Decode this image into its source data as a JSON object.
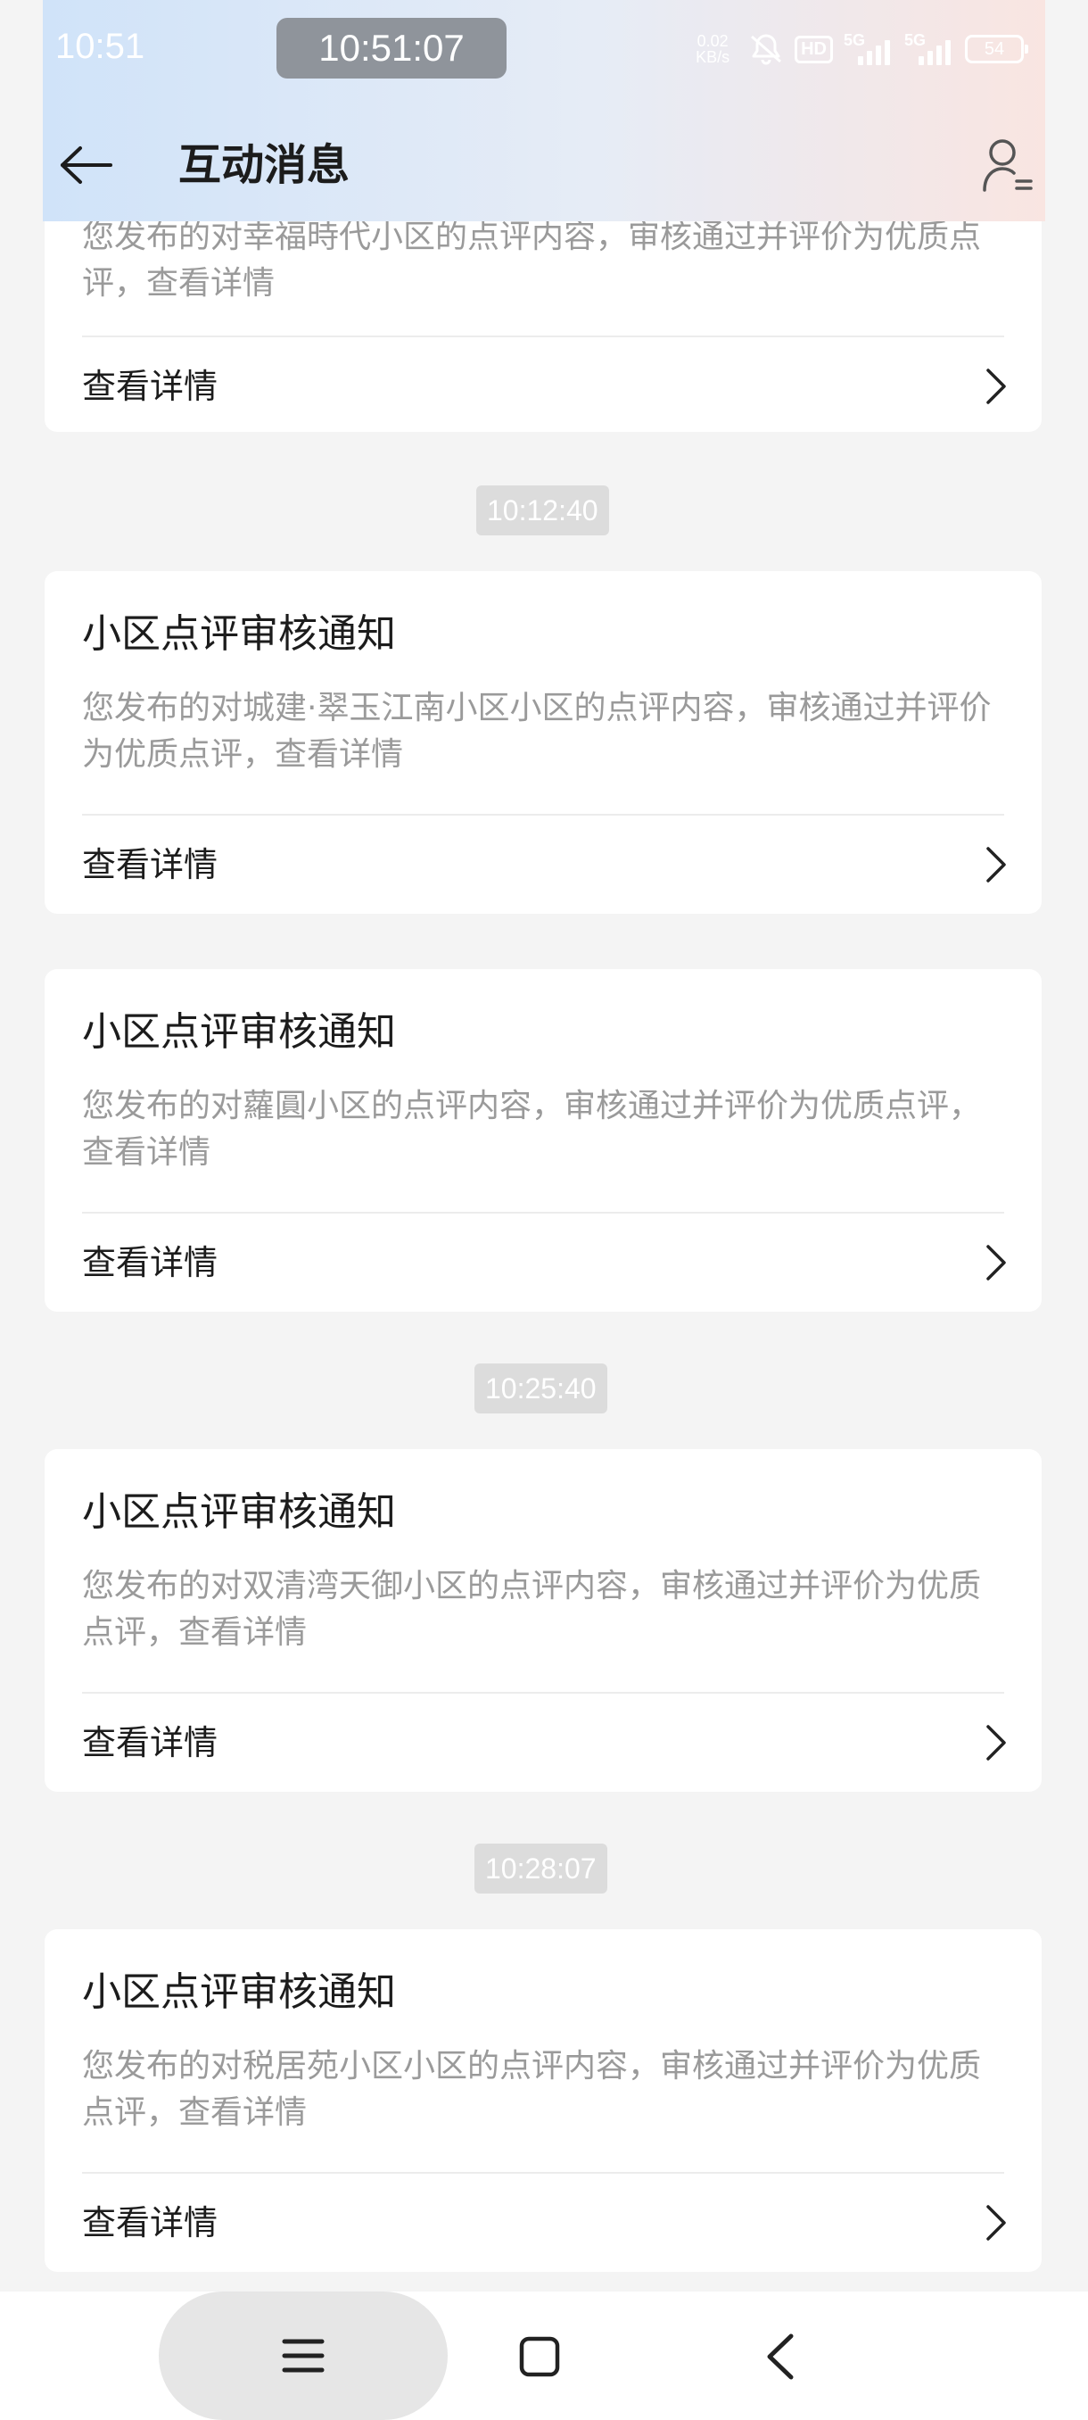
{
  "status_bar": {
    "time": "10:51",
    "clock": "10:51:07",
    "net_speed_value": "0.02",
    "net_speed_unit": "KB/s",
    "hd_label": "HD",
    "signal_1": "5G",
    "signal_2": "5G",
    "battery": "54"
  },
  "header": {
    "title": "互动消息"
  },
  "feed": {
    "partial_card": {
      "body": "您发布的对幸福時代小区的点评内容，审核通过并评价为优质点评，查看详情",
      "action": "查看详情"
    },
    "timestamps": [
      "10:12:40",
      "10:25:40",
      "10:28:07"
    ],
    "cards": [
      {
        "title": "小区点评审核通知",
        "body": "您发布的对城建·翠玉江南小区小区的点评内容，审核通过并评价为优质点评，查看详情",
        "action": "查看详情"
      },
      {
        "title": "小区点评审核通知",
        "body": "您发布的对蘿圓小区的点评内容，审核通过并评价为优质点评，查看详情",
        "action": "查看详情"
      },
      {
        "title": "小区点评审核通知",
        "body": "您发布的对双清湾天御小区的点评内容，审核通过并评价为优质点评，查看详情",
        "action": "查看详情"
      },
      {
        "title": "小区点评审核通知",
        "body": "您发布的对税居苑小区小区的点评内容，审核通过并评价为优质点评，查看详情",
        "action": "查看详情"
      }
    ]
  },
  "icons": {
    "back": "arrow-left-icon",
    "profile": "user-settings-icon",
    "chevron": "chevron-right-icon",
    "nav_menu": "menu-icon",
    "nav_home": "square-icon",
    "nav_back": "chevron-left-icon"
  },
  "colors": {
    "background": "#f4f4f4",
    "card": "#ffffff",
    "title_text": "#1c1c1c",
    "body_text": "#9a9a9a",
    "timestamp_bg": "#dcdcdc"
  }
}
